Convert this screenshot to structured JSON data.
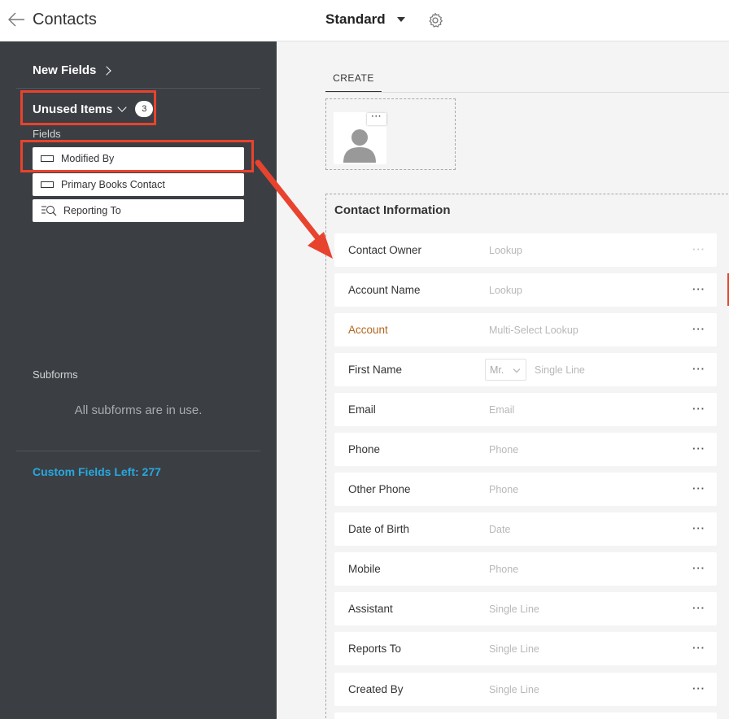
{
  "header": {
    "title": "Contacts",
    "layout_name": "Standard"
  },
  "sidebar": {
    "new_fields": "New Fields",
    "unused_items": "Unused Items",
    "unused_count": "3",
    "fields_heading": "Fields",
    "fields": [
      {
        "label": "Modified By",
        "icon": "single-line-field-icon"
      },
      {
        "label": "Primary Books Contact",
        "icon": "single-line-field-icon"
      },
      {
        "label": "Reporting To",
        "icon": "lookup-field-icon"
      }
    ],
    "subforms_heading": "Subforms",
    "subforms_message": "All subforms are in use.",
    "custom_fields_left": "Custom Fields Left: 277"
  },
  "main": {
    "tab_create": "CREATE",
    "section_title": "Contact Information",
    "rows": [
      {
        "label": "Contact Owner",
        "type": "Lookup"
      },
      {
        "label": "Account Name",
        "type": "Lookup"
      },
      {
        "label": "Account",
        "type": "Multi-Select Lookup"
      },
      {
        "label": "First Name",
        "type": "Single Line",
        "salutation": "Mr."
      },
      {
        "label": "Email",
        "type": "Email"
      },
      {
        "label": "Phone",
        "type": "Phone"
      },
      {
        "label": "Other Phone",
        "type": "Phone"
      },
      {
        "label": "Date of Birth",
        "type": "Date"
      },
      {
        "label": "Mobile",
        "type": "Phone"
      },
      {
        "label": "Assistant",
        "type": "Single Line"
      },
      {
        "label": "Reports To",
        "type": "Single Line"
      },
      {
        "label": "Created By",
        "type": "Single Line"
      }
    ],
    "row_menu": "···",
    "avatar_menu": "···"
  },
  "colors": {
    "sidebar_bg": "#3b3f44",
    "highlight_red": "#e8432e",
    "custom_fields_blue": "#27a9e1",
    "account_label_orange": "#b5651d"
  }
}
